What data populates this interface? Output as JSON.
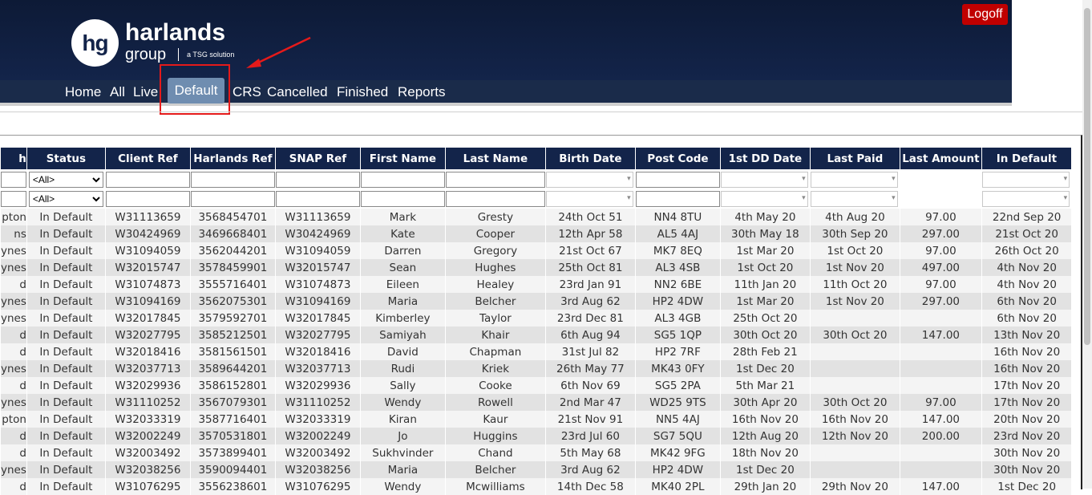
{
  "header": {
    "logoff_label": "Logoff",
    "logo_mark": "hg",
    "logo_name": "harlands",
    "logo_sub": "group",
    "logo_tagline": "a TSG solution"
  },
  "nav": {
    "items": [
      {
        "label": "Home"
      },
      {
        "label": "All"
      },
      {
        "label": "Live"
      },
      {
        "label": "Default",
        "active": true
      },
      {
        "label": "CRS"
      },
      {
        "label": "Cancelled"
      },
      {
        "label": "Finished"
      },
      {
        "label": "Reports"
      }
    ]
  },
  "colors": {
    "header_bg": "#13244a",
    "active_tab": "#6f8db0",
    "logoff": "#c00000",
    "highlight": "#e51a1a"
  },
  "table": {
    "columns": [
      "h",
      "Status",
      "Client Ref",
      "Harlands Ref",
      "SNAP Ref",
      "First Name",
      "Last Name",
      "Birth Date",
      "Post Code",
      "1st DD Date",
      "Last Paid",
      "Last Amount",
      "In Default"
    ],
    "status_filter_option": "<All>",
    "rows": [
      [
        "pton",
        "In Default",
        "W31113659",
        "3568454701",
        "W31113659",
        "Mark",
        "Gresty",
        "24th Oct 51",
        "NN4 8TU",
        "4th May 20",
        "4th Aug 20",
        "97.00",
        "22nd Sep 20"
      ],
      [
        "ns",
        "In Default",
        "W30424969",
        "3469668401",
        "W30424969",
        "Kate",
        "Cooper",
        "12th Apr 58",
        "AL5 4AJ",
        "30th May 18",
        "30th Sep 20",
        "297.00",
        "21st Oct 20"
      ],
      [
        "ynes",
        "In Default",
        "W31094059",
        "3562044201",
        "W31094059",
        "Darren",
        "Gregory",
        "21st Oct 67",
        "MK7 8EQ",
        "1st Mar 20",
        "1st Oct 20",
        "97.00",
        "26th Oct 20"
      ],
      [
        "ynes",
        "In Default",
        "W32015747",
        "3578459901",
        "W32015747",
        "Sean",
        "Hughes",
        "25th Oct 81",
        "AL3 4SB",
        "1st Oct 20",
        "1st Nov 20",
        "497.00",
        "4th Nov 20"
      ],
      [
        "d",
        "In Default",
        "W31074873",
        "3555716401",
        "W31074873",
        "Eileen",
        "Healey",
        "23rd Jan 91",
        "NN2 6BE",
        "11th Jan 20",
        "11th Oct 20",
        "97.00",
        "4th Nov 20"
      ],
      [
        "ynes",
        "In Default",
        "W31094169",
        "3562075301",
        "W31094169",
        "Maria",
        "Belcher",
        "3rd Aug 62",
        "HP2 4DW",
        "1st Mar 20",
        "1st Nov 20",
        "297.00",
        "6th Nov 20"
      ],
      [
        "ynes",
        "In Default",
        "W32017845",
        "3579592701",
        "W32017845",
        "Kimberley",
        "Taylor",
        "23rd Dec 81",
        "AL3 4GB",
        "25th Oct 20",
        "",
        "",
        "6th Nov 20"
      ],
      [
        "d",
        "In Default",
        "W32027795",
        "3585212501",
        "W32027795",
        "Samiyah",
        "Khair",
        "6th Aug 94",
        "SG5 1QP",
        "30th Oct 20",
        "30th Oct 20",
        "147.00",
        "13th Nov 20"
      ],
      [
        "d",
        "In Default",
        "W32018416",
        "3581561501",
        "W32018416",
        "David",
        "Chapman",
        "31st Jul 82",
        "HP2 7RF",
        "28th Feb 21",
        "",
        "",
        "16th Nov 20"
      ],
      [
        "ynes",
        "In Default",
        "W32037713",
        "3589644201",
        "W32037713",
        "Rudi",
        "Kriek",
        "26th May 77",
        "MK43 0FY",
        "1st Dec 20",
        "",
        "",
        "16th Nov 20"
      ],
      [
        "d",
        "In Default",
        "W32029936",
        "3586152801",
        "W32029936",
        "Sally",
        "Cooke",
        "6th Nov 69",
        "SG5 2PA",
        "5th Mar 21",
        "",
        "",
        "17th Nov 20"
      ],
      [
        "ynes",
        "In Default",
        "W31110252",
        "3567079301",
        "W31110252",
        "Wendy",
        "Rowell",
        "2nd Mar 47",
        "WD25 9TS",
        "30th Apr 20",
        "30th Oct 20",
        "97.00",
        "17th Nov 20"
      ],
      [
        "pton",
        "In Default",
        "W32033319",
        "3587716401",
        "W32033319",
        "Kiran",
        "Kaur",
        "21st Nov 91",
        "NN5 4AJ",
        "16th Nov 20",
        "16th Nov 20",
        "147.00",
        "20th Nov 20"
      ],
      [
        "d",
        "In Default",
        "W32002249",
        "3570531801",
        "W32002249",
        "Jo",
        "Huggins",
        "23rd Jul 60",
        "SG7 5QU",
        "12th Aug 20",
        "12th Nov 20",
        "200.00",
        "23rd Nov 20"
      ],
      [
        "d",
        "In Default",
        "W32003492",
        "3573899401",
        "W32003492",
        "Sukhvinder",
        "Chand",
        "5th May 68",
        "MK42 9FG",
        "18th Nov 20",
        "",
        "",
        "30th Nov 20"
      ],
      [
        "ynes",
        "In Default",
        "W32038256",
        "3590094401",
        "W32038256",
        "Maria",
        "Belcher",
        "3rd Aug 62",
        "HP2 4DW",
        "1st Dec 20",
        "",
        "",
        "30th Nov 20"
      ],
      [
        "d",
        "In Default",
        "W31076295",
        "3556238601",
        "W31076295",
        "Wendy",
        "Mcwilliams",
        "14th Dec 58",
        "MK40 2PL",
        "29th Jan 20",
        "29th Nov 20",
        "147.00",
        "1st Dec 20"
      ]
    ]
  }
}
